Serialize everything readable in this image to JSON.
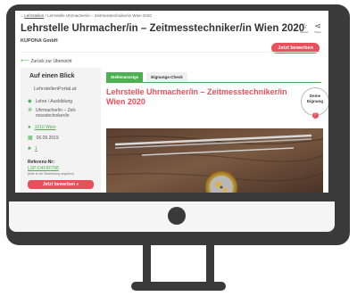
{
  "breadcrumb": {
    "home_icon": "home-icon",
    "link": "Lehrstellen",
    "separator": " / ",
    "current": "Lehrstelle Uhrmacher/in – Zeitmesstechniker/in Wien 2020"
  },
  "job": {
    "title": "Lehrstelle Uhrmacher/in – Zeitmesstechniker/in Wien 2020",
    "company": "KUPONA GmbH"
  },
  "actions": {
    "remember_label": "Merken",
    "share_label": "Teilen",
    "apply_label": "Jetzt bewerben"
  },
  "back_label": "Zurück zur Übersicht",
  "sidebar": {
    "heading": "Auf einen Blick",
    "logo_text": "LehrstellenPortal.at",
    "type": "Lehre / Ausbildung",
    "profession_1": "Uhrmacher/in – Zeit-",
    "profession_2": "messtechniker/in",
    "location": "1010 Wien",
    "date": "06.09.2019",
    "positions": "1",
    "ref_heading": "Referenz-Nr:",
    "ref_value": "LSP-D4F9F798",
    "ref_note": "(bitte in der Bewerbung angeben)",
    "apply_label": "Jetzt bewerben »"
  },
  "tabs": [
    {
      "label": "Stellenanzeige",
      "active": true
    },
    {
      "label": "Eignungs-Check",
      "active": false
    }
  ],
  "main": {
    "title": "Lehrstelle Uhrmacher/in – Zeitmesstechniker/in Wien 2020",
    "badge_line1": "Deine",
    "badge_line2": "Eignung",
    "badge_symbol": "?"
  },
  "colors": {
    "accent_red": "#e8505b",
    "accent_green": "#4caf50",
    "frame": "#3a3a3a"
  }
}
